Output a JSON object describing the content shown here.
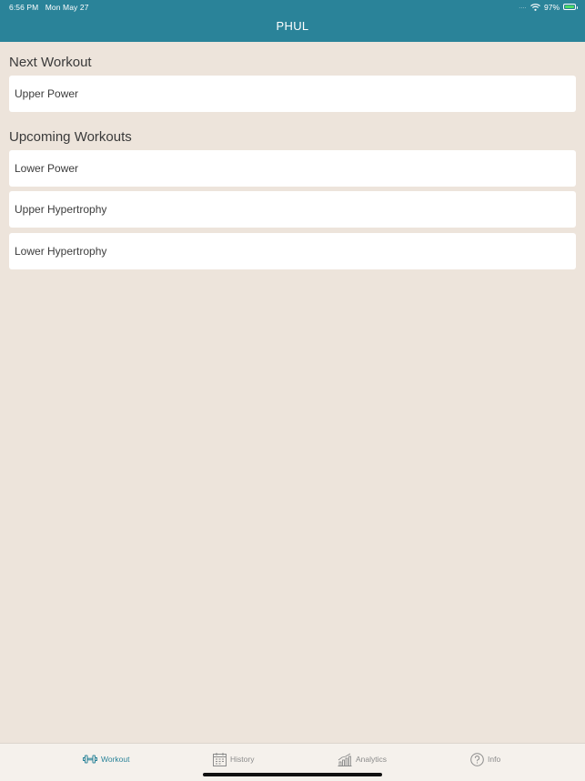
{
  "status_bar": {
    "time": "6:56 PM",
    "date": "Mon May 27",
    "signal": "....",
    "battery_percent": "97%",
    "battery_level": 0.97
  },
  "nav": {
    "title": "PHUL"
  },
  "next_section": {
    "title": "Next Workout",
    "items": [
      {
        "label": "Upper Power"
      }
    ]
  },
  "upcoming_section": {
    "title": "Upcoming Workouts",
    "items": [
      {
        "label": "Lower Power"
      },
      {
        "label": "Upper Hypertrophy"
      },
      {
        "label": "Lower Hypertrophy"
      }
    ]
  },
  "tabs": [
    {
      "label": "Workout",
      "icon": "dumbbell-icon",
      "active": true
    },
    {
      "label": "History",
      "icon": "calendar-icon",
      "active": false
    },
    {
      "label": "Analytics",
      "icon": "bar-chart-icon",
      "active": false
    },
    {
      "label": "Info",
      "icon": "question-circle-icon",
      "active": false
    }
  ],
  "colors": {
    "header": "#2a8399",
    "background": "#ede4db",
    "active_tab": "#2a8399",
    "inactive_tab": "#8b8b8b"
  }
}
